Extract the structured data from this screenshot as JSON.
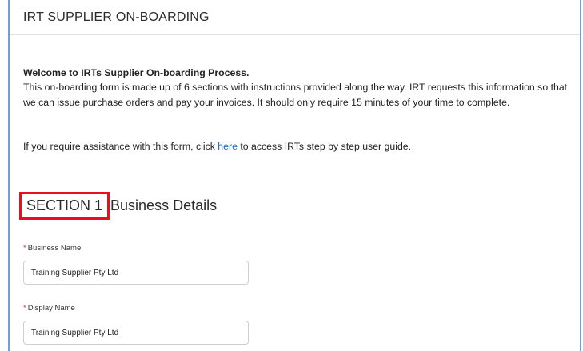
{
  "header": {
    "title": "IRT SUPPLIER ON-BOARDING"
  },
  "intro": {
    "welcome": "Welcome to IRTs Supplier On-boarding Process.",
    "body": "This on-boarding form is made up of 6 sections with instructions provided along the way.  IRT requests this information so that we can issue purchase orders and pay your invoices. It should only require 15 minutes of your time to complete.",
    "assist_before": "If you require assistance with this form, click ",
    "assist_link": "here",
    "assist_after": " to access IRTs step by step user guide."
  },
  "section": {
    "number": "SECTION 1",
    "title": "Business Details",
    "highlight_color": "#e8101f"
  },
  "fields": {
    "required_marker": "*",
    "business_name": {
      "label": "Business Name",
      "value": "Training Supplier Pty Ltd"
    },
    "display_name": {
      "label": "Display Name",
      "value": "Training Supplier Pty Ltd"
    }
  }
}
